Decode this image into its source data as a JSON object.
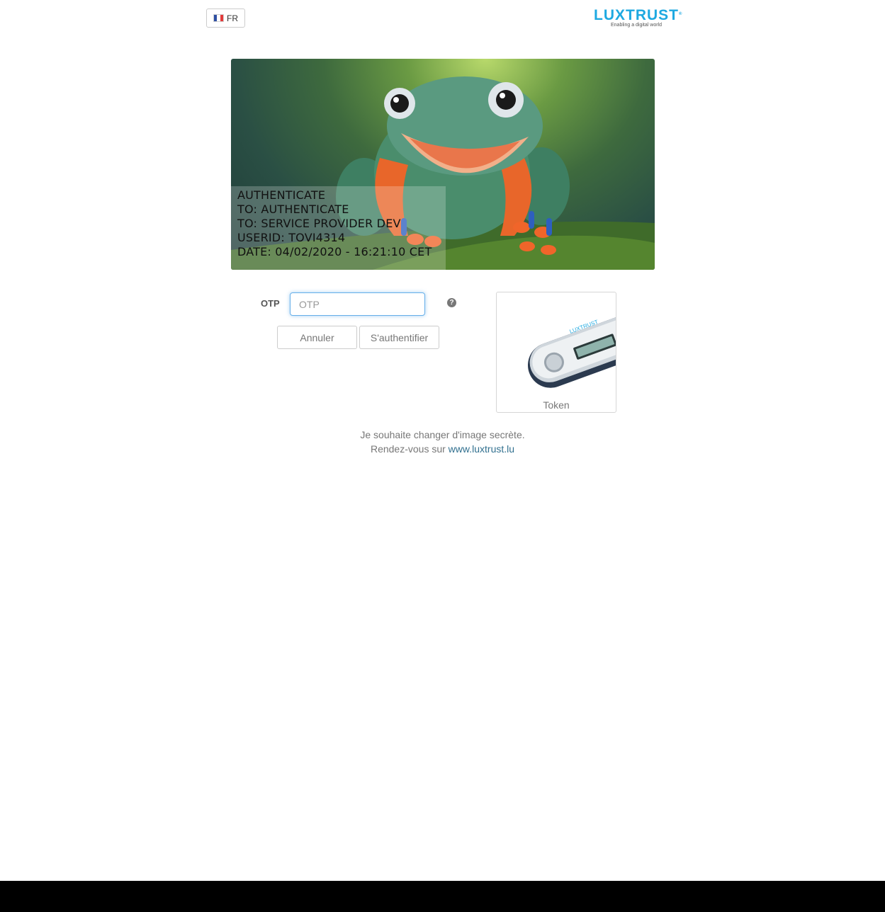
{
  "header": {
    "language_label": "FR",
    "logo": {
      "name": "LUXTRUST",
      "registered_mark": "®",
      "tagline": "Enabling a digital world"
    }
  },
  "secret_image": {
    "subject": "frog-icon",
    "lines": [
      "AUTHENTICATE",
      "TO: AUTHENTICATE",
      "TO: SERVICE PROVIDER DEV",
      "USERID: TOVI4314",
      "DATE: 04/02/2020 - 16:21:10 CET"
    ]
  },
  "form": {
    "otp_label": "OTP",
    "otp_placeholder": "OTP",
    "otp_value": "",
    "help_icon": "?",
    "cancel_label": "Annuler",
    "authenticate_label": "S'authentifier"
  },
  "token": {
    "label": "Token",
    "device_brand": "LUXTRUST"
  },
  "info": {
    "line1": "Je souhaite changer d'image secrète.",
    "line2_prefix": "Rendez-vous sur",
    "link_text": "www.luxtrust.lu"
  },
  "colors": {
    "accent": "#1ea9e1",
    "link": "#31708f",
    "focus": "#66afe9",
    "bottom_bar": "#000000"
  }
}
